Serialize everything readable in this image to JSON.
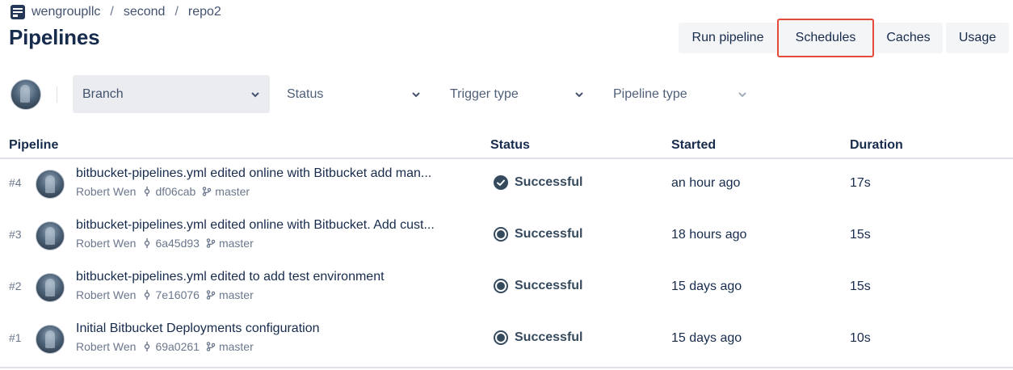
{
  "breadcrumb": {
    "icon": "repository-icon",
    "items": [
      "wengroupllc",
      "second",
      "repo2"
    ],
    "separator": "/"
  },
  "page": {
    "title": "Pipelines"
  },
  "actions": {
    "run_pipeline": "Run pipeline",
    "schedules": "Schedules",
    "caches": "Caches",
    "usage": "Usage",
    "highlight_color": "#e5493a"
  },
  "filters": {
    "branch": "Branch",
    "status": "Status",
    "trigger_type": "Trigger type",
    "pipeline_type": "Pipeline type"
  },
  "table": {
    "headers": {
      "pipeline": "Pipeline",
      "status": "Status",
      "started": "Started",
      "duration": "Duration"
    },
    "rows": [
      {
        "number": "#4",
        "title": "bitbucket-pipelines.yml edited online with Bitbucket add man...",
        "author": "Robert Wen",
        "commit": "df06cab",
        "branch": "master",
        "status": "Successful",
        "status_icon": "check-circle-icon",
        "started": "an hour ago",
        "duration": "17s"
      },
      {
        "number": "#3",
        "title": "bitbucket-pipelines.yml edited online with Bitbucket. Add cust...",
        "author": "Robert Wen",
        "commit": "6a45d93",
        "branch": "master",
        "status": "Successful",
        "status_icon": "target-circle-icon",
        "started": "18 hours ago",
        "duration": "15s"
      },
      {
        "number": "#2",
        "title": "bitbucket-pipelines.yml edited to add test environment",
        "author": "Robert Wen",
        "commit": "7e16076",
        "branch": "master",
        "status": "Successful",
        "status_icon": "target-circle-icon",
        "started": "15 days ago",
        "duration": "15s"
      },
      {
        "number": "#1",
        "title": "Initial Bitbucket Deployments configuration",
        "author": "Robert Wen",
        "commit": "69a0261",
        "branch": "master",
        "status": "Successful",
        "status_icon": "target-circle-icon",
        "started": "15 days ago",
        "duration": "10s"
      }
    ]
  },
  "colors": {
    "status_success": "#364a5e",
    "text_primary": "#172b4d",
    "text_muted": "#6b778c"
  }
}
